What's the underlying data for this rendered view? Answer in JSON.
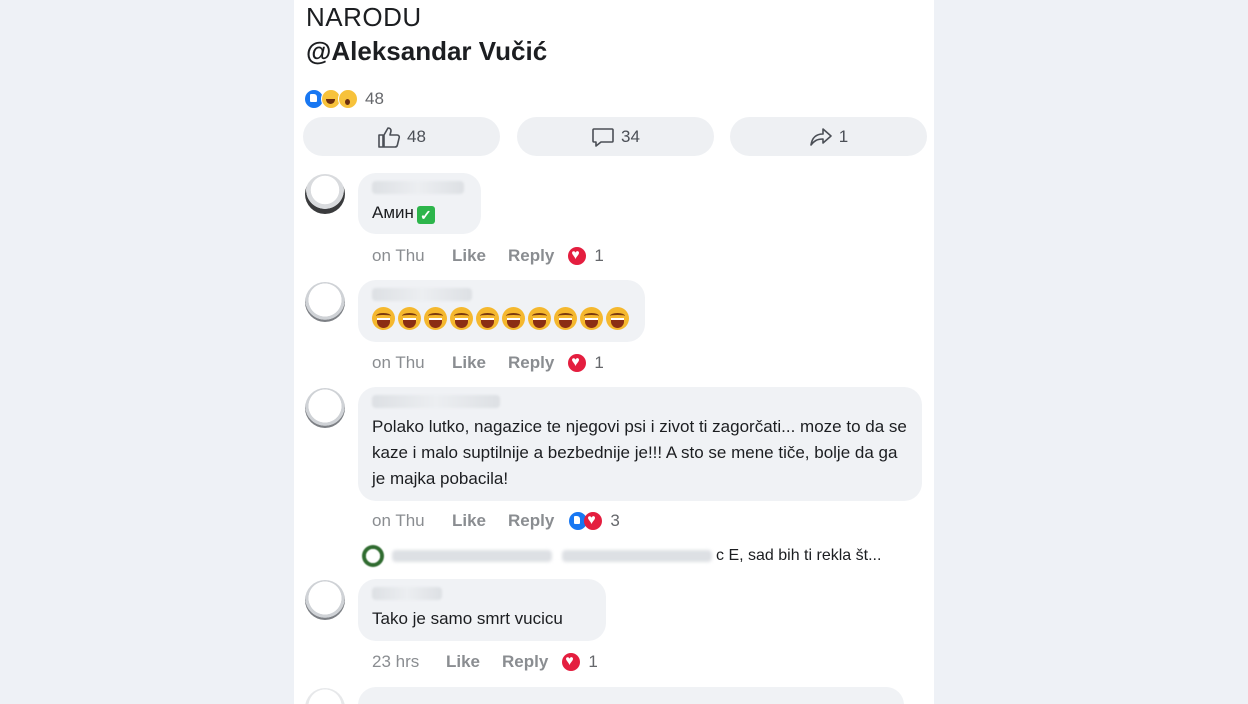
{
  "post": {
    "line1": "NARODU",
    "line2": "@Aleksandar Vučić",
    "reaction_icons": [
      "like-icon",
      "haha-icon",
      "wow-icon"
    ],
    "reaction_count": "48"
  },
  "actions": {
    "like_count": "48",
    "comment_count": "34",
    "share_count": "1"
  },
  "comments": [
    {
      "text": "Амин",
      "emoji": "✓",
      "time": "on Thu",
      "like_label": "Like",
      "reply_label": "Reply",
      "reactions": "1"
    },
    {
      "text": "",
      "laugh_count": 10,
      "time": "on Thu",
      "like_label": "Like",
      "reply_label": "Reply",
      "reactions": "1"
    },
    {
      "text": "Polako lutko, nagazice te njegovi psi i zivot ti zagorčati... moze to da se kaze i malo suptilnije a bezbednije je!!! A sto se mene tiče, bolje da ga je majka pobacila!",
      "time": "on Thu",
      "like_label": "Like",
      "reply_label": "Reply",
      "reactions": "3"
    },
    {
      "text": "Tako je samo smrt vucicu",
      "time": "23 hrs",
      "like_label": "Like",
      "reply_label": "Reply",
      "reactions": "1"
    }
  ],
  "reply_preview": {
    "text": "c E, sad bih ti rekla št..."
  },
  "colors": {
    "accent": "#1877f2",
    "love": "#e41e3f",
    "bubble": "#f0f2f5"
  }
}
